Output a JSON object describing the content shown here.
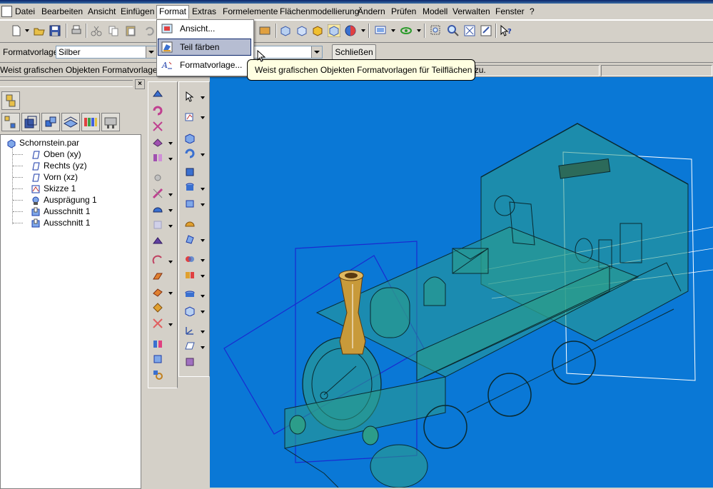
{
  "menubar": {
    "items": [
      "Datei",
      "Bearbeiten",
      "Ansicht",
      "Einfügen",
      "Format",
      "Extras",
      "Formelemente",
      "Flächenmodellierung",
      "Ändern",
      "Prüfen",
      "Modell",
      "Verwalten",
      "Fenster",
      "?"
    ]
  },
  "format_menu": {
    "items": [
      {
        "label": "Ansicht...",
        "icon": "view-format-icon"
      },
      {
        "label": "Teil färben",
        "icon": "paint-part-icon"
      },
      {
        "label": "Formatvorlage...",
        "icon": "style-icon"
      }
    ],
    "highlighted": 1
  },
  "tooltip": {
    "text": "Weist grafischen Objekten Formatvorlagen für Teilflächen zu."
  },
  "formatbar": {
    "label": "Formatvorlage:",
    "style_value": "Silber",
    "close_label": "Schließen"
  },
  "statusline": {
    "text": "Weist grafischen Objekten Formatvorlagen für"
  },
  "tree": {
    "items": [
      {
        "label": "Schornstein.par",
        "icon": "part-file-icon",
        "level": 0
      },
      {
        "label": "Oben (xy)",
        "icon": "plane-icon",
        "level": 1
      },
      {
        "label": "Rechts (yz)",
        "icon": "plane-icon",
        "level": 1
      },
      {
        "label": "Vorn (xz)",
        "icon": "plane-icon",
        "level": 1
      },
      {
        "label": "Skizze 1",
        "icon": "sketch-icon",
        "level": 1
      },
      {
        "label": "Ausprägung 1",
        "icon": "protrusion-icon",
        "level": 1
      },
      {
        "label": "Ausschnitt 1",
        "icon": "cutout-icon",
        "level": 1
      },
      {
        "label": "Ausschnitt 1",
        "icon": "cutout-icon",
        "level": 1
      }
    ]
  },
  "colors": {
    "viewport_bg": "#0a78d6",
    "model_fill": "#2c9d8a",
    "chimney": "#c89a3a",
    "menu_highlight": "#b6bdd2",
    "tooltip_bg": "#ffffe1"
  }
}
